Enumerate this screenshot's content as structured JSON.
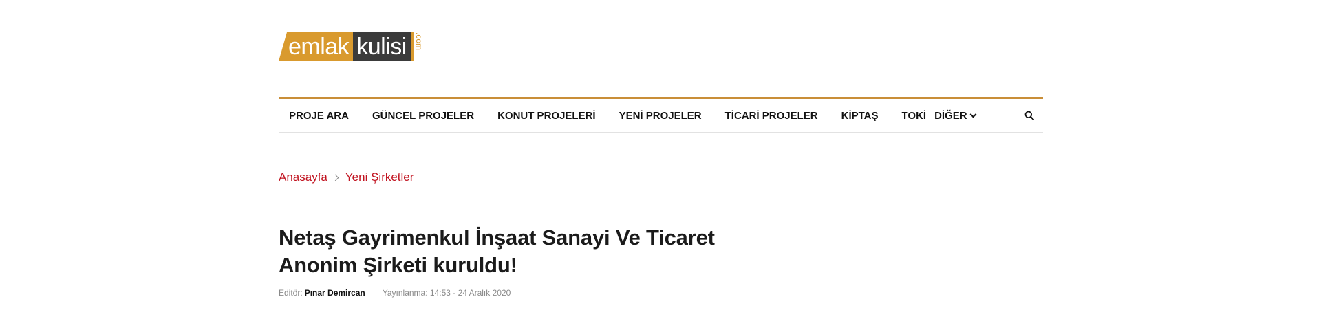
{
  "logo": {
    "part1": "emlak",
    "part2": "kulisi",
    "suffix": ".com"
  },
  "nav": {
    "items": [
      {
        "label": "PROJE ARA"
      },
      {
        "label": "GÜNCEL PROJELER"
      },
      {
        "label": "KONUT PROJELERİ"
      },
      {
        "label": "YENİ PROJELER"
      },
      {
        "label": "TİCARİ PROJELER"
      },
      {
        "label": "KİPTAŞ"
      },
      {
        "label": "TOKİ"
      },
      {
        "label": "DİĞER"
      }
    ]
  },
  "breadcrumb": {
    "home": "Anasayfa",
    "category": "Yeni Şirketler"
  },
  "article": {
    "title": "Netaş Gayrimenkul İnşaat Sanayi Ve Ticaret Anonim Şirketi kuruldu!",
    "editor_label": "Editör:",
    "editor_name": "Pınar Demircan",
    "published": "Yayınlanma: 14:53 - 24 Aralık 2020"
  },
  "colors": {
    "accent": "#d99a2e",
    "dark": "#3b3b3b",
    "link": "#c1121f"
  },
  "icons": {
    "search": "search-icon",
    "chevron": "chevron-down-icon",
    "separator": "chevron-right-icon"
  }
}
